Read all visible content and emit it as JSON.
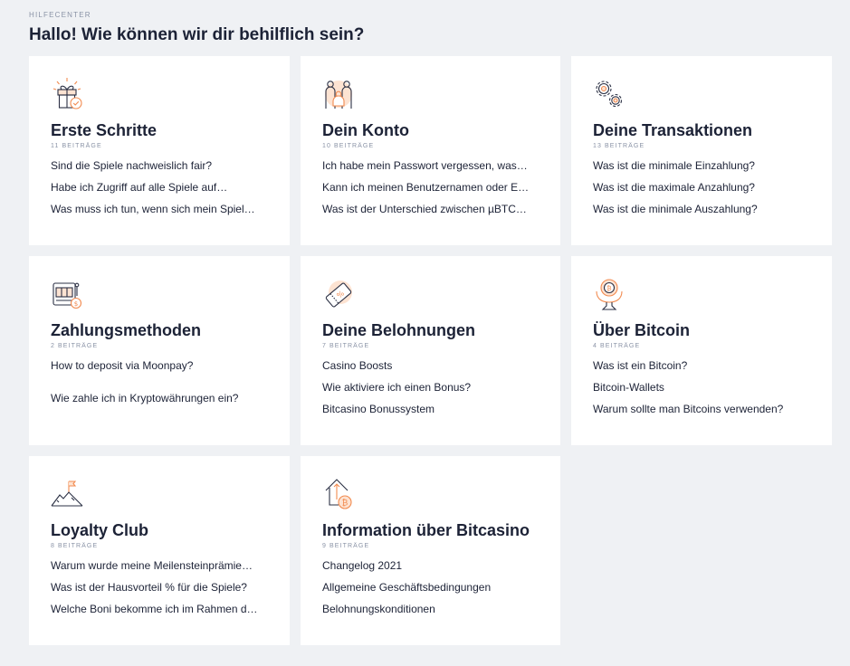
{
  "header": {
    "eyebrow": "HILFECENTER",
    "title": "Hallo! Wie können wir dir behilflich sein?"
  },
  "colors": {
    "accent": "#f28b50",
    "accent_light": "#fde3d2",
    "ink": "#1c2236",
    "muted": "#8a93a6",
    "background": "#eff1f4"
  },
  "cards": [
    {
      "icon": "gift-icon",
      "title": "Erste Schritte",
      "count": "11 BEITRÄGE",
      "links": [
        "Sind die Spiele nachweislich fair?",
        "Habe ich Zugriff auf alle Spiele auf…",
        "Was muss ich tun, wenn sich mein Spiel…"
      ]
    },
    {
      "icon": "account-people-icon",
      "title": "Dein Konto",
      "count": "10 BEITRÄGE",
      "links": [
        "Ich habe mein Passwort vergessen, was…",
        "Kann ich meinen Benutzernamen oder E…",
        "Was ist der Unterschied zwischen µBTC…"
      ]
    },
    {
      "icon": "gears-icon",
      "title": "Deine Transaktionen",
      "count": "13 BEITRÄGE",
      "links": [
        "Was ist die minimale Einzahlung?",
        "Was ist die maximale Anzahlung?",
        "Was ist die minimale Auszahlung?"
      ]
    },
    {
      "icon": "slot-machine-icon",
      "title": "Zahlungsmethoden",
      "count": "2 BEITRÄGE",
      "links": [
        "How to deposit via Moonpay?",
        "Wie zahle ich in Kryptowährungen ein?"
      ]
    },
    {
      "icon": "voucher-icon",
      "title": "Deine Belohnungen",
      "count": "7 BEITRÄGE",
      "links": [
        "Casino Boosts",
        "Wie aktiviere ich einen Bonus?",
        "Bitcasino Bonussystem"
      ]
    },
    {
      "icon": "bitcoin-trophy-icon",
      "title": "Über Bitcoin",
      "count": "4 BEITRÄGE",
      "links": [
        "Was ist ein Bitcoin?",
        "Bitcoin-Wallets",
        "Warum sollte man Bitcoins verwenden?"
      ]
    },
    {
      "icon": "mountain-flag-icon",
      "title": "Loyalty Club",
      "count": "8 BEITRÄGE",
      "links": [
        "Warum wurde meine Meilensteinprämie…",
        "Was ist der Hausvorteil % für die Spiele?",
        "Welche Boni bekomme ich im Rahmen d…"
      ]
    },
    {
      "icon": "house-bitcoin-icon",
      "title": "Information über Bitcasino",
      "count": "9 BEITRÄGE",
      "links": [
        "Changelog 2021",
        "Allgemeine Geschäftsbedingungen",
        "Belohnungskonditionen"
      ]
    }
  ]
}
